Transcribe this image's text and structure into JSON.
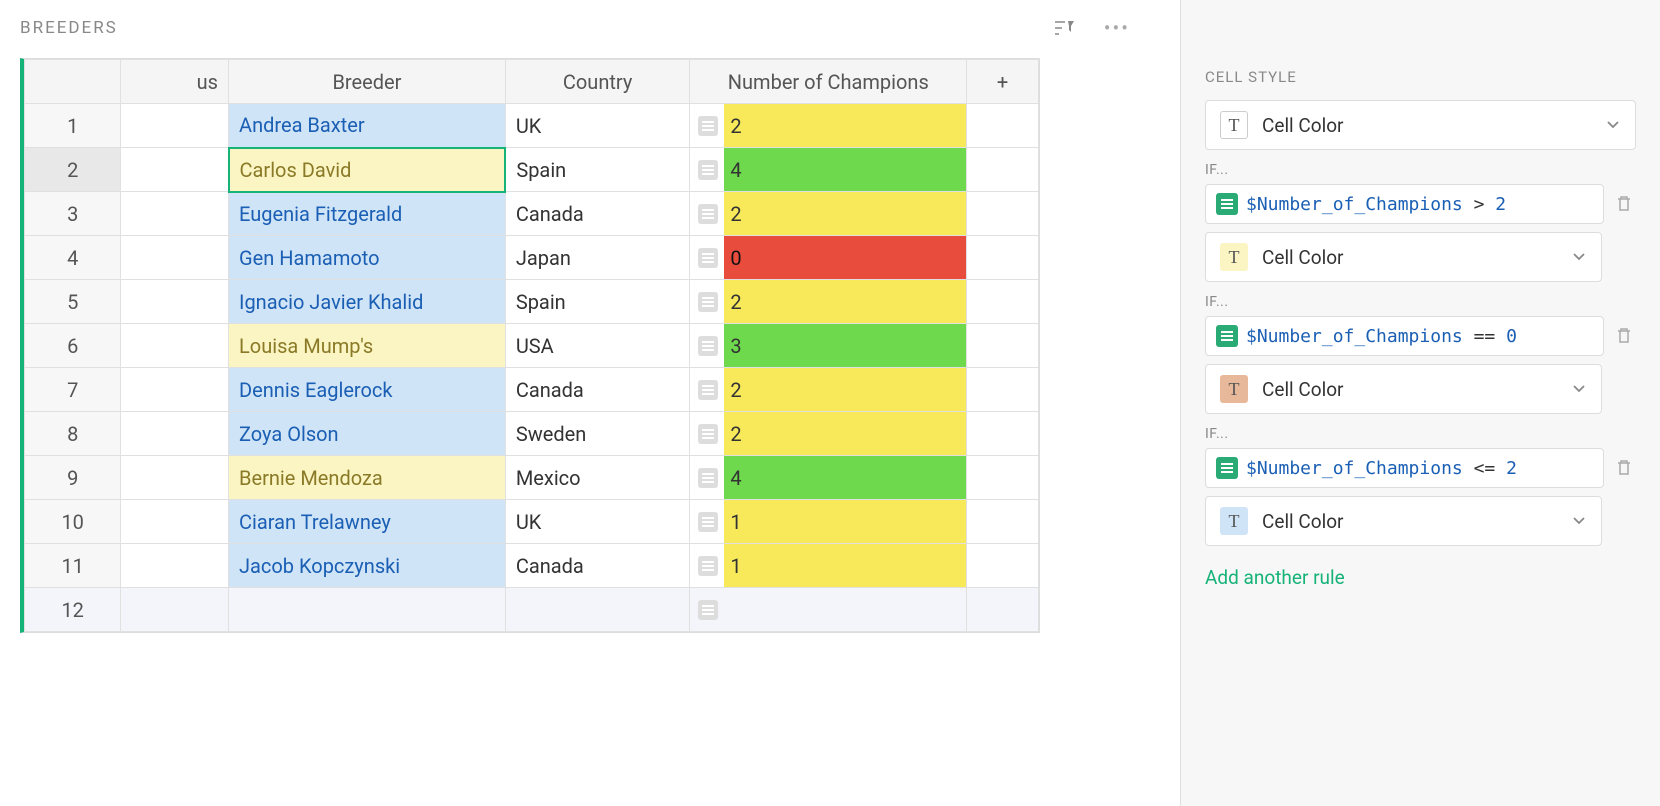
{
  "section": {
    "title": "BREEDERS"
  },
  "columns": {
    "us_partial": "us",
    "breeder": "Breeder",
    "country": "Country",
    "champions": "Number of Champions",
    "add": "+"
  },
  "rows": [
    {
      "n": "1",
      "breeder": "Andrea Baxter",
      "country": "UK",
      "champs": "2",
      "style": "blue",
      "color": "yellow"
    },
    {
      "n": "2",
      "breeder": "Carlos David",
      "country": "Spain",
      "champs": "4",
      "style": "yellow",
      "color": "green",
      "selected": true
    },
    {
      "n": "3",
      "breeder": "Eugenia Fitzgerald",
      "country": "Canada",
      "champs": "2",
      "style": "blue",
      "color": "yellow"
    },
    {
      "n": "4",
      "breeder": "Gen Hamamoto",
      "country": "Japan",
      "champs": "0",
      "style": "blue",
      "color": "red"
    },
    {
      "n": "5",
      "breeder": "Ignacio Javier Khalid",
      "country": "Spain",
      "champs": "2",
      "style": "blue",
      "color": "yellow"
    },
    {
      "n": "6",
      "breeder": "Louisa Mump's",
      "country": "USA",
      "champs": "3",
      "style": "yellow",
      "color": "green"
    },
    {
      "n": "7",
      "breeder": "Dennis Eaglerock",
      "country": "Canada",
      "champs": "2",
      "style": "blue",
      "color": "yellow"
    },
    {
      "n": "8",
      "breeder": "Zoya Olson",
      "country": "Sweden",
      "champs": "2",
      "style": "blue",
      "color": "yellow"
    },
    {
      "n": "9",
      "breeder": "Bernie Mendoza",
      "country": "Mexico",
      "champs": "4",
      "style": "yellow",
      "color": "green"
    },
    {
      "n": "10",
      "breeder": "Ciaran Trelawney",
      "country": "UK",
      "champs": "1",
      "style": "blue",
      "color": "yellow"
    },
    {
      "n": "11",
      "breeder": "Jacob Kopczynski",
      "country": "Canada",
      "champs": "1",
      "style": "blue",
      "color": "yellow"
    }
  ],
  "add_row_num": "12",
  "panel": {
    "title": "CELL STYLE",
    "default_select": "Cell Color",
    "if_label": "IF...",
    "rules": [
      {
        "var": "$Number_of_Champions",
        "op": ">",
        "val": "2",
        "swatch": "yellow",
        "label": "Cell Color"
      },
      {
        "var": "$Number_of_Champions",
        "op": "==",
        "val": "0",
        "swatch": "salmon",
        "label": "Cell Color"
      },
      {
        "var": "$Number_of_Champions",
        "op": "<=",
        "val": "2",
        "swatch": "blue",
        "label": "Cell Color"
      }
    ],
    "add_rule": "Add another rule"
  }
}
